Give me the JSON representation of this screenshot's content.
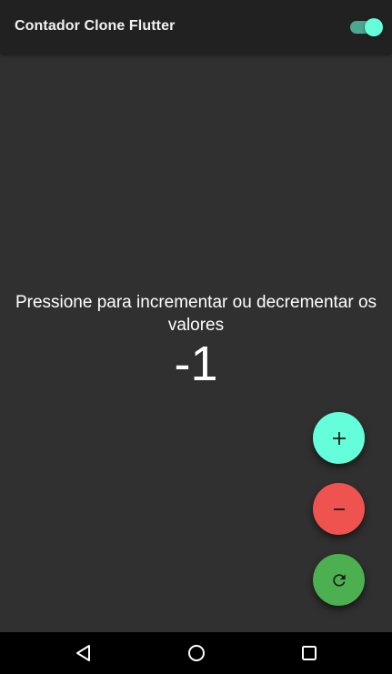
{
  "app_bar": {
    "title": "Contador Clone Flutter",
    "theme_switch_on": true
  },
  "main": {
    "instruction": "Pressione para incrementar ou decrementar os valores",
    "counter_value": "-1"
  },
  "actions": {
    "increment_icon": "plus-icon",
    "decrement_icon": "minus-icon",
    "reset_icon": "refresh-icon"
  },
  "colors": {
    "background": "#303030",
    "app_bar": "#212121",
    "accent": "#64ffda",
    "increment": "#64ffda",
    "decrement": "#ef5350",
    "reset": "#4caf50"
  },
  "navigation": {
    "back_icon": "back-triangle-icon",
    "home_icon": "home-circle-icon",
    "recents_icon": "recents-square-icon"
  }
}
